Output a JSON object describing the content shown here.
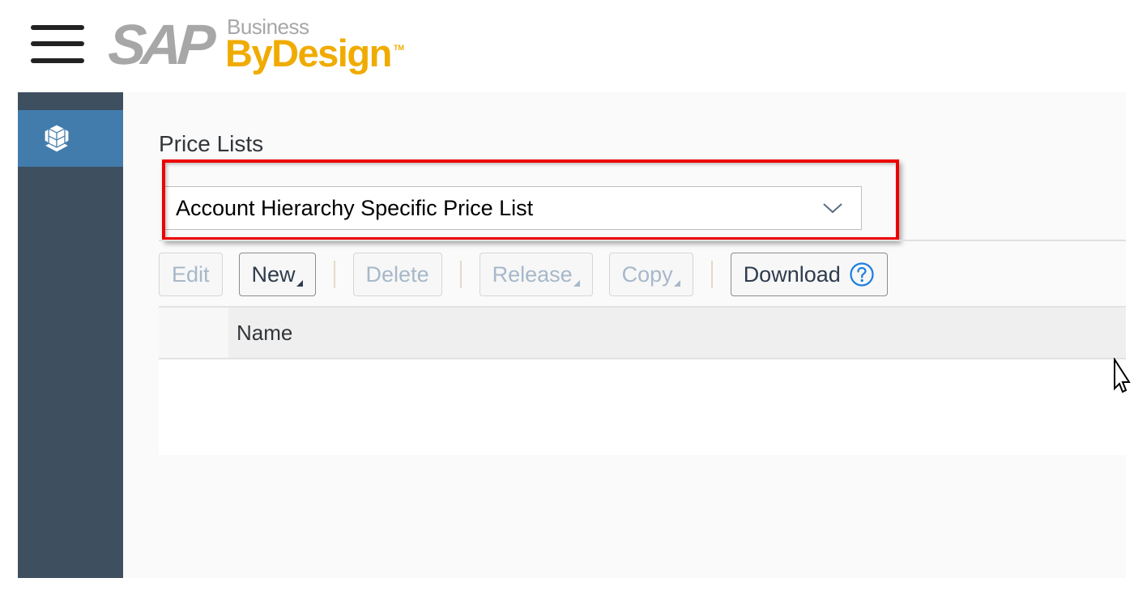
{
  "header": {
    "menu_icon": "hamburger-icon",
    "logo": {
      "sap": "SAP",
      "business": "Business",
      "bydesign": "ByDesign",
      "tm": "TM"
    }
  },
  "sidebar": {
    "items": [
      {
        "icon": "cube-icon",
        "active": true
      }
    ]
  },
  "main": {
    "title": "Price Lists",
    "select": {
      "value": "Account Hierarchy Specific Price List",
      "icon": "chevron-down-icon",
      "highlighted": true
    },
    "toolbar": {
      "edit": "Edit",
      "new": "New",
      "delete": "Delete",
      "release": "Release",
      "copy": "Copy",
      "download": "Download",
      "help_icon": "question-circle-icon"
    },
    "table": {
      "columns": [
        "Name"
      ],
      "rows": []
    }
  },
  "colors": {
    "sidebar_bg": "#3e4f60",
    "sidebar_active": "#427cac",
    "highlight_border": "#ee0000",
    "brand_gray": "#a7a7a7",
    "brand_gold": "#f0ab00",
    "help_blue": "#1a7ee0"
  }
}
